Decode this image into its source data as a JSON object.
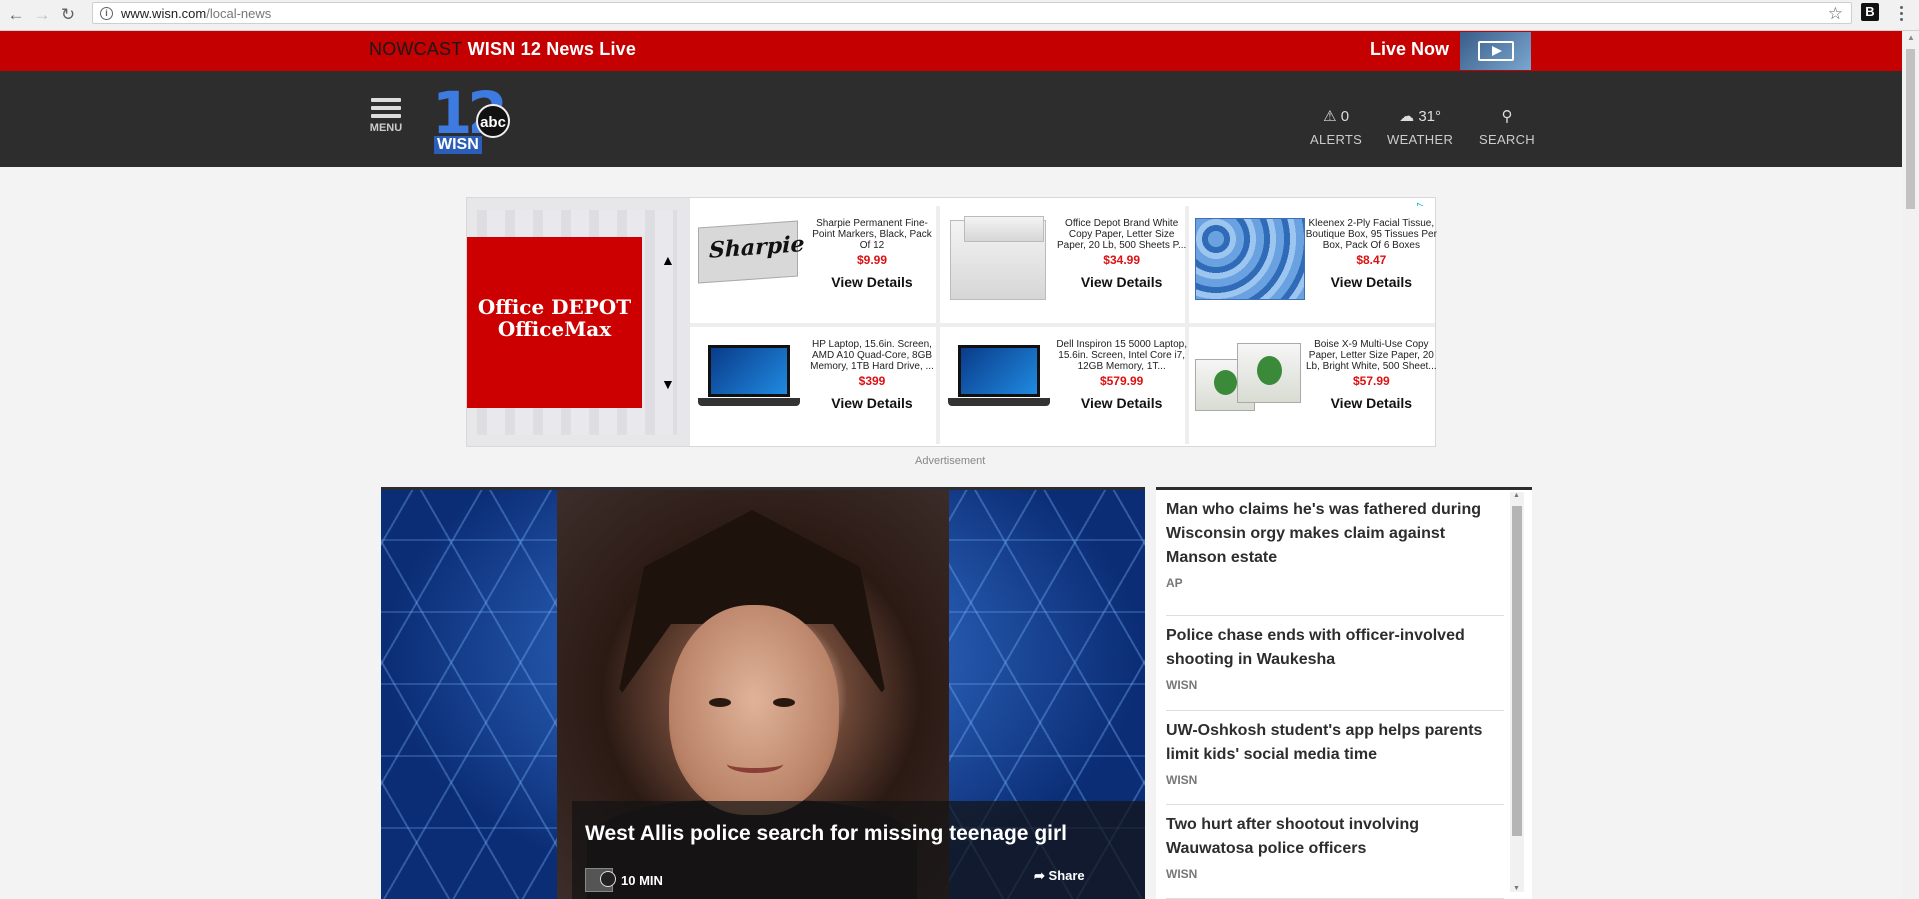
{
  "browser": {
    "url_host": "www.wisn.com",
    "url_path": "/local-news",
    "back_icon": "back-arrow-icon",
    "forward_icon": "forward-arrow-icon",
    "reload_icon": "reload-icon",
    "bookmark_icon": "star-icon",
    "extension_label": "B"
  },
  "breaking_bar": {
    "label": "NOWCAST",
    "title": "WISN 12 News Live",
    "live_label": "Live Now",
    "color": "#c40000"
  },
  "header": {
    "menu_label": "MENU",
    "logo_text": "WISN",
    "logo_badge": "abc",
    "alerts": {
      "count": "0",
      "label": "ALERTS"
    },
    "weather": {
      "temp": "31°",
      "label": "WEATHER"
    },
    "search": {
      "label": "SEARCH"
    }
  },
  "ad": {
    "brand_line1": "Office DEPOT",
    "brand_line2": "OfficeMax",
    "caption": "Advertisement",
    "products": [
      {
        "name": "Sharpie Permanent Fine-Point Markers, Black, Pack Of 12",
        "price": "$9.99",
        "cta": "View Details"
      },
      {
        "name": "Office Depot Brand White Copy Paper, Letter Size Paper, 20 Lb, 500 Sheets P...",
        "price": "$34.99",
        "cta": "View Details"
      },
      {
        "name": "Kleenex 2-Ply Facial Tissue, Boutique Box, 95 Tissues Per Box, Pack Of 6 Boxes",
        "price": "$8.47",
        "cta": "View Details"
      },
      {
        "name": "HP Laptop, 15.6in. Screen, AMD A10 Quad-Core, 8GB Memory, 1TB Hard Drive, ...",
        "price": "$399",
        "cta": "View Details"
      },
      {
        "name": "Dell Inspiron 15 5000 Laptop, 15.6in. Screen, Intel Core i7, 12GB Memory, 1T...",
        "price": "$579.99",
        "cta": "View Details"
      },
      {
        "name": "Boise X-9 Multi-Use Copy Paper, Letter Size Paper, 20 Lb, Bright White, 500 Sheet...",
        "price": "$57.99",
        "cta": "View Details"
      }
    ]
  },
  "hero": {
    "title": "West Allis police search for missing teenage girl",
    "time": "10 MIN",
    "share_label": "Share"
  },
  "side_stories": [
    {
      "title": "Man who claims he's was fathered during Wisconsin orgy makes claim against Manson estate",
      "source": "AP"
    },
    {
      "title": "Police chase ends with officer-involved shooting in Waukesha",
      "source": "WISN"
    },
    {
      "title": "UW-Oshkosh student's app helps parents limit kids' social media time",
      "source": "WISN"
    },
    {
      "title": "Two hurt after shootout involving Wauwatosa police officers",
      "source": "WISN"
    }
  ]
}
